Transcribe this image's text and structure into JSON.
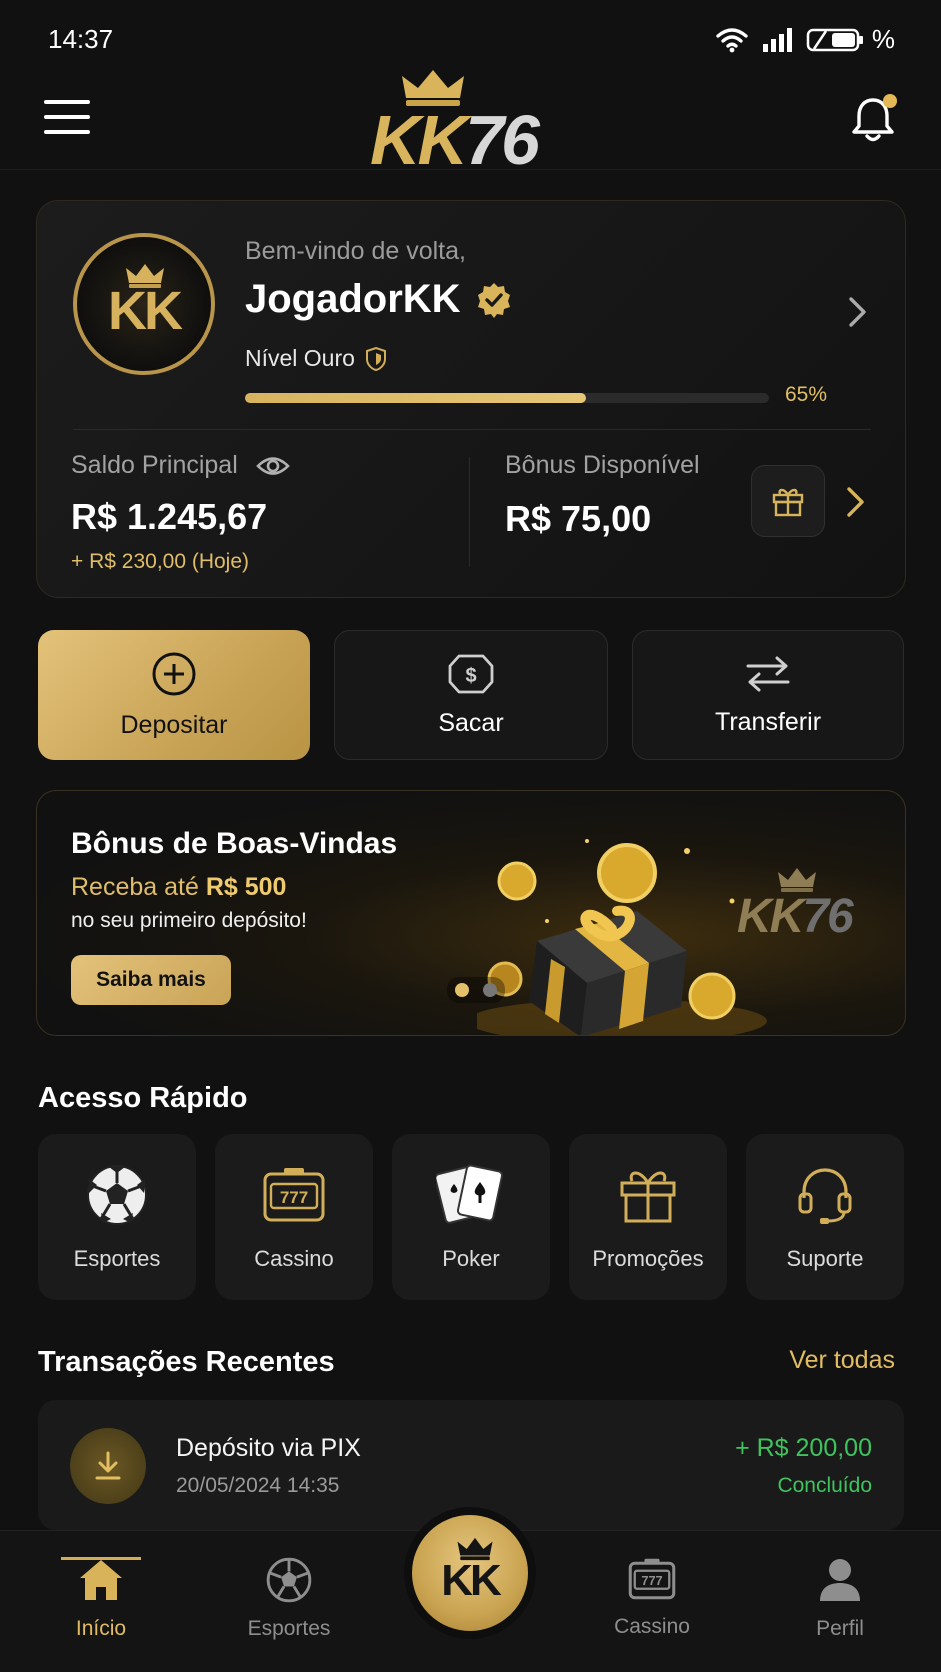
{
  "status_bar": {
    "time": "14:37",
    "battery": "%"
  },
  "header": {
    "logo_kk": "KK",
    "logo_num": "76"
  },
  "profile": {
    "avatar_text": "KK",
    "welcome": "Bem-vindo de volta,",
    "username": "JogadorKK",
    "level": "Nível Ouro",
    "progress_percent": 65,
    "progress_label": "65%"
  },
  "balance": {
    "main_label": "Saldo Principal",
    "main_value": "R$ 1.245,67",
    "today": "+ R$ 230,00 (Hoje)",
    "bonus_label": "Bônus Disponível",
    "bonus_value": "R$ 75,00"
  },
  "actions": {
    "deposit": "Depositar",
    "withdraw": "Sacar",
    "transfer": "Transferir"
  },
  "promo": {
    "title": "Bônus de Boas-Vindas",
    "sub_prefix": "Receba até",
    "sub_amount": "R$ 500",
    "sub2": "no seu primeiro depósito!",
    "button": "Saiba mais",
    "logo_kk": "KK",
    "logo_num": "76"
  },
  "quick_access": {
    "title": "Acesso Rápido",
    "items": [
      {
        "label": "Esportes",
        "icon": "soccer-ball-icon"
      },
      {
        "label": "Cassino",
        "icon": "slot-machine-icon"
      },
      {
        "label": "Poker",
        "icon": "playing-cards-icon"
      },
      {
        "label": "Promoções",
        "icon": "gift-icon"
      },
      {
        "label": "Suporte",
        "icon": "headset-icon"
      }
    ]
  },
  "transactions": {
    "title": "Transações Recentes",
    "see_all": "Ver todas",
    "items": [
      {
        "title": "Depósito via PIX",
        "date": "20/05/2024 14:35",
        "amount": "+ R$ 200,00",
        "status": "Concluído"
      }
    ]
  },
  "bottom_nav": {
    "items": [
      {
        "label": "Início",
        "icon": "home-icon"
      },
      {
        "label": "Esportes",
        "icon": "soccer-ball-icon"
      },
      {
        "label": "Cassino",
        "icon": "slot-machine-icon"
      },
      {
        "label": "Perfil",
        "icon": "user-icon"
      }
    ],
    "center_text": "KK"
  },
  "colors": {
    "accent_gold": "#e1bc63",
    "positive_green": "#3ec45f",
    "background": "#111111"
  }
}
